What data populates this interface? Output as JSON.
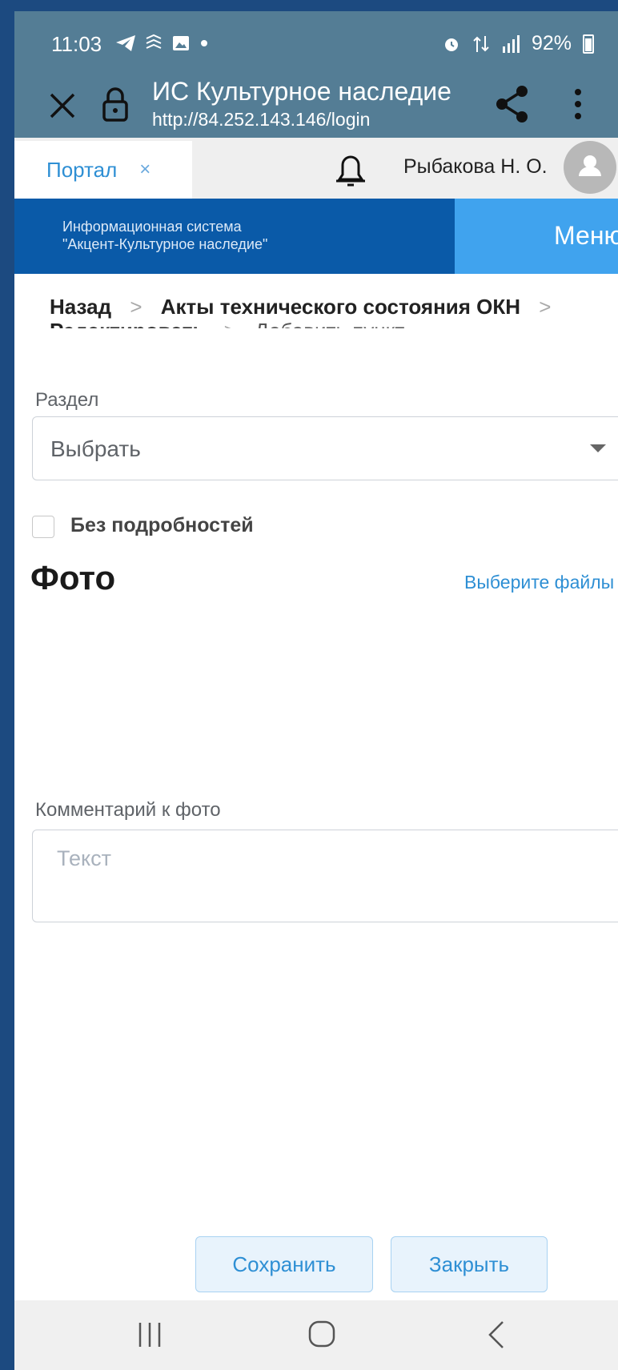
{
  "status_bar": {
    "time": "11:03",
    "battery": "92%",
    "icons": [
      "telegram-icon",
      "app-icon",
      "gallery-icon",
      "dot-icon",
      "alarm-icon",
      "data-icon",
      "signal-icon",
      "battery-icon"
    ]
  },
  "browser": {
    "title": "ИС Культурное наследие",
    "url": "http://84.252.143.146/login"
  },
  "tabbar": {
    "tab_label": "Портал",
    "tab_close": "×",
    "user_name": "Рыбакова Н. О."
  },
  "banner": {
    "line1": "Информационная система",
    "line2": "\"Акцент-Культурное наследие\"",
    "menu": "Меню"
  },
  "breadcrumbs": {
    "back": "Назад",
    "section": "Акты технического состояния ОКН",
    "edit": "Редактировать",
    "current": "Добавить пункт"
  },
  "form": {
    "section_label": "Раздел",
    "section_value": "Выбрать",
    "checkbox_label": "Без подробностей",
    "photo_heading": "Фото",
    "choose_files": "Выберите файлы",
    "comment_label": "Комментарий к фото",
    "comment_placeholder": "Текст"
  },
  "buttons": {
    "save": "Сохранить",
    "close": "Закрыть"
  },
  "colors": {
    "status_bar": "#547d95",
    "banner": "#0a5aa8",
    "menu": "#40a3ee",
    "link": "#2e8fd4"
  }
}
